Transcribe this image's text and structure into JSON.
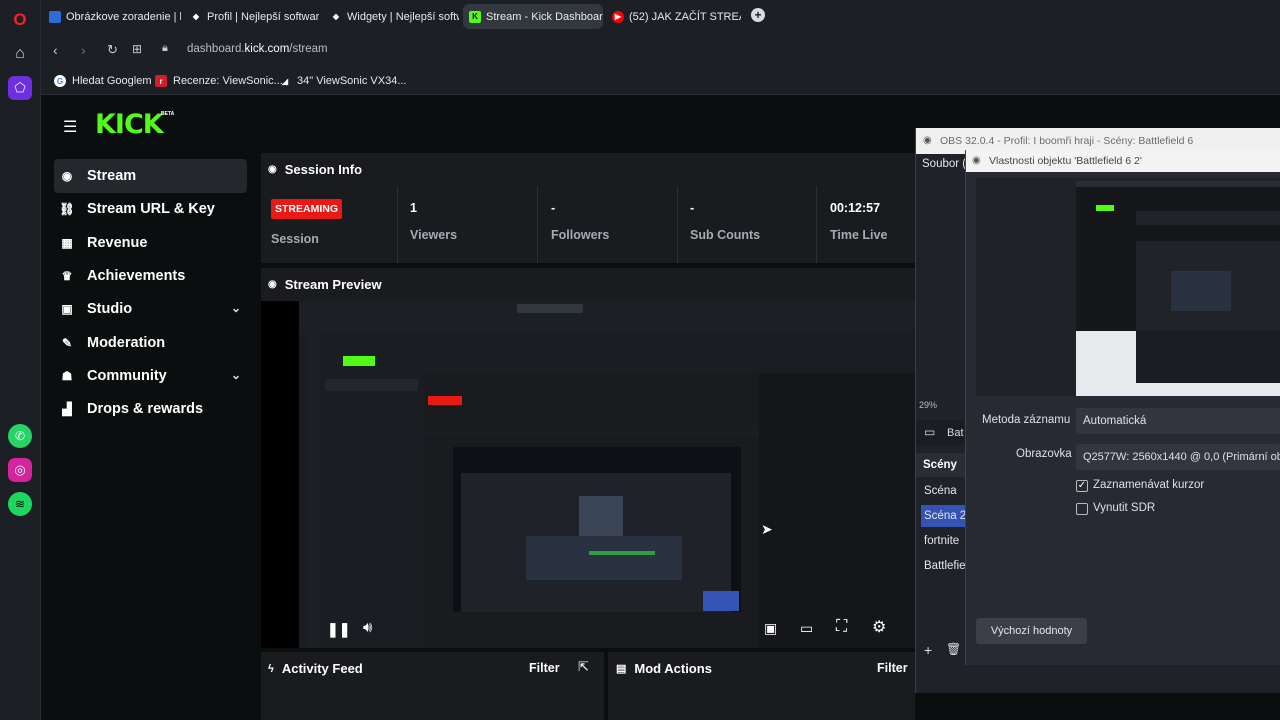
{
  "browser": {
    "tabs": [
      {
        "title": "Obrázkove zoradenie | bo",
        "icon": "blue-icon"
      },
      {
        "title": "Profil | Nejlepší software p",
        "icon": "diamond-icon"
      },
      {
        "title": "Widgety | Nejlepší softwa",
        "icon": "diamond-icon"
      },
      {
        "title": "Stream - Kick Dashboard",
        "icon": "kick-icon"
      },
      {
        "title": "(52) JAK ZAČÍT STREAMOV",
        "icon": "youtube-icon"
      }
    ],
    "url_host": "dashboard.kick.com",
    "url_prefix": "dashboard.",
    "url_domain": "kick.com",
    "url_path": "/stream",
    "bookmarks": [
      "Hledat Googlem",
      "Recenze: ViewSonic...",
      "34\" ViewSonic VX34..."
    ]
  },
  "kick": {
    "logo": "KICK",
    "logo_badge": "BETA",
    "menu": [
      {
        "label": "Stream",
        "icon": "broadcast-icon"
      },
      {
        "label": "Stream URL & Key",
        "icon": "link-icon"
      },
      {
        "label": "Revenue",
        "icon": "chart-icon"
      },
      {
        "label": "Achievements",
        "icon": "trophy-icon"
      },
      {
        "label": "Studio",
        "icon": "studio-icon"
      },
      {
        "label": "Moderation",
        "icon": "wrench-icon"
      },
      {
        "label": "Community",
        "icon": "users-icon"
      },
      {
        "label": "Drops & rewards",
        "icon": "drops-icon"
      }
    ],
    "session": {
      "title": "Session Info",
      "status_badge": "STREAMING",
      "session_label": "Session",
      "stats": [
        {
          "value": "1",
          "label": "Viewers"
        },
        {
          "value": "-",
          "label": "Followers"
        },
        {
          "value": "-",
          "label": "Sub Counts"
        },
        {
          "value": "00:12:57",
          "label": "Time Live"
        }
      ]
    },
    "preview_title": "Stream Preview",
    "activity_title": "Activity Feed",
    "activity_filter": "Filter",
    "mod_title": "Mod Actions",
    "mod_filter": "Filter"
  },
  "obs": {
    "title": "OBS 32.0.4 - Profil: I boomři hraji - Scény: Battlefield 6",
    "menu_file": "Soubor (",
    "dialog_title": "Vlastnosti objektu 'Battlefield 6 2'",
    "zoom": "29%",
    "source_short": "Bat",
    "method_label": "Metoda záznamu",
    "method_value": "Automatická",
    "screen_label": "Obrazovka",
    "screen_value": "Q2577W: 2560x1440 @ 0,0 (Primární ob",
    "cursor_label": "Zaznamenávat kurzor",
    "cursor_checked": true,
    "sdr_label": "Vynutit SDR",
    "sdr_checked": false,
    "defaults_button": "Výchozí hodnoty",
    "scenes_title": "Scény",
    "scenes": [
      "Scéna",
      "Scéna 2",
      "fortnite",
      "Battlefield"
    ],
    "selected_scene": "Scéna 2"
  },
  "colors": {
    "kick_green": "#53fc18",
    "streaming_red": "#e91916",
    "obs_selected": "#3553b5"
  }
}
